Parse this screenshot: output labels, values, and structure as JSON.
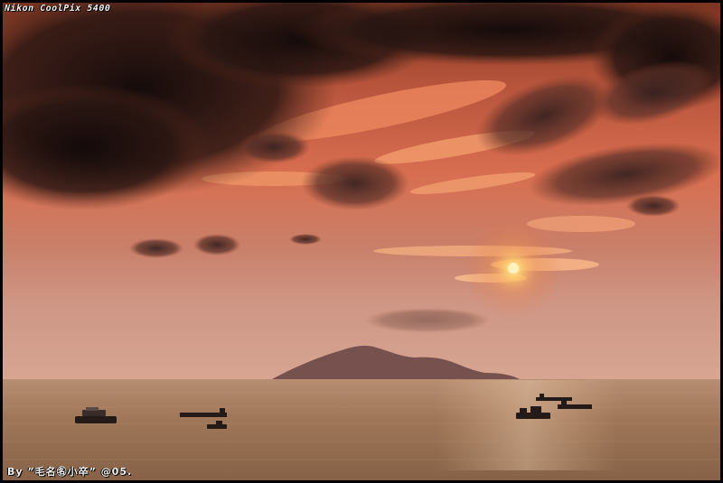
{
  "photo": {
    "camera_watermark": "Nikon CoolPix 5400",
    "credit_watermark": "By ”毛名㊔小卒” @05."
  },
  "colors": {
    "sky_top": "#a24a2a",
    "sky_mid": "#d9704a",
    "sky_low": "#c9846a",
    "horizon": "#d99a80",
    "sea": "#a37a5a",
    "cloud_dark": "#1c1212",
    "sun": "#fff2c0"
  }
}
